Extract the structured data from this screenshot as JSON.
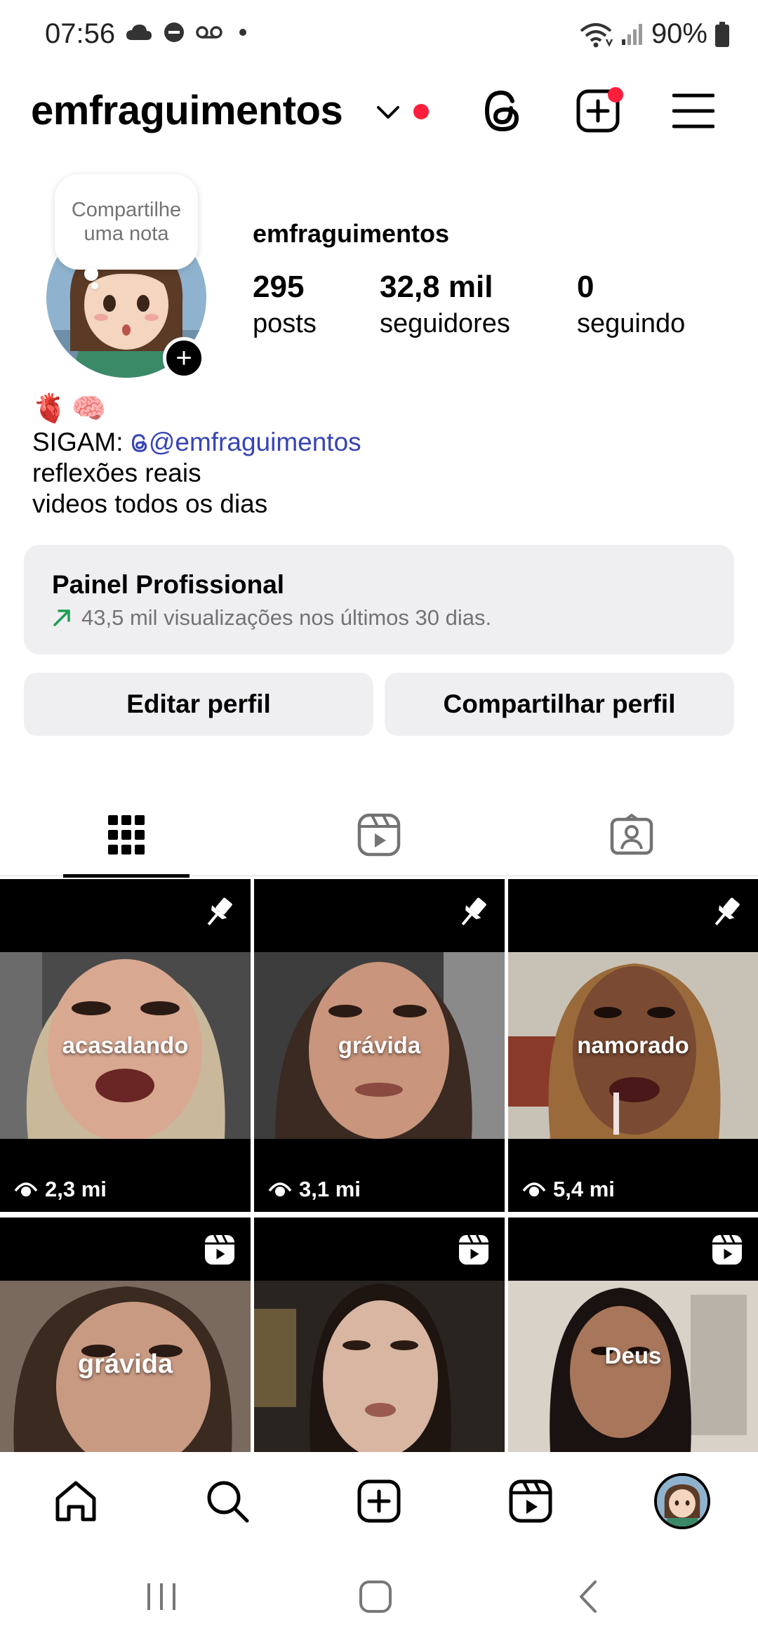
{
  "status_bar": {
    "time": "07:56",
    "battery": "90%",
    "icons": [
      "cloud-icon",
      "do-not-disturb-icon",
      "voicemail-icon",
      "dot-icon",
      "wifi-icon",
      "signal-icon",
      "battery-icon"
    ]
  },
  "header": {
    "username": "emfraguimentos",
    "icons": [
      "chevron-down-icon",
      "threads-icon",
      "create-icon",
      "menu-icon"
    ],
    "accent_dot_color": "#ff1f3d"
  },
  "profile": {
    "note": "Compartilhe uma nota",
    "name": "emfraguimentos",
    "stats": [
      {
        "value": "295",
        "label": "posts"
      },
      {
        "value": "32,8 mil",
        "label": "seguidores"
      },
      {
        "value": "0",
        "label": "seguindo"
      }
    ],
    "bio": {
      "emoji": [
        "🫀",
        "🧠"
      ],
      "sigam_prefix": "SIGAM:",
      "threads_handle": "@emfraguimentos",
      "lines": [
        "reflexões reais",
        "videos todos os dias"
      ]
    }
  },
  "professional_panel": {
    "title": "Painel Profissional",
    "subtitle": "43,5 mil visualizações nos últimos 30 dias."
  },
  "buttons": {
    "edit": "Editar perfil",
    "share": "Compartilhar perfil"
  },
  "tabs": [
    "grid-icon",
    "reels-icon",
    "tagged-icon"
  ],
  "grid": [
    {
      "caption": "acasalando",
      "views": "2,3 mi",
      "corner": "pin-icon"
    },
    {
      "caption": "grávida",
      "views": "3,1 mi",
      "corner": "pin-icon"
    },
    {
      "caption": "namorado",
      "views": "5,4 mi",
      "corner": "pin-icon"
    },
    {
      "caption": "grávida",
      "views": "",
      "corner": "reels-icon"
    },
    {
      "caption": "",
      "views": "",
      "corner": "reels-icon"
    },
    {
      "caption": "Deus",
      "views": "",
      "corner": "reels-icon"
    }
  ],
  "bottom_nav": [
    "home-icon",
    "search-icon",
    "create-icon",
    "reels-icon",
    "profile-avatar"
  ],
  "system_nav": [
    "recents-icon",
    "home-icon",
    "back-icon"
  ]
}
